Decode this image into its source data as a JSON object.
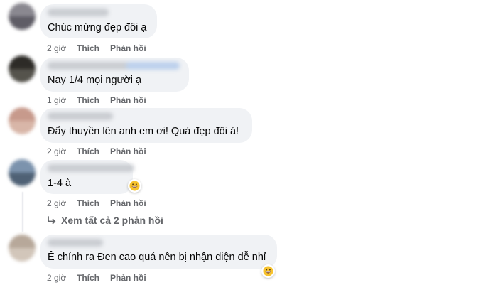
{
  "comments": [
    {
      "text": "Chúc mừng đẹp đôi ạ",
      "time": "2 giờ",
      "like": "Thích",
      "reply": "Phản hồi",
      "avatar_colors": [
        "#8a8890",
        "#5f5d66"
      ]
    },
    {
      "text": "Nay 1/4 mọi người ạ",
      "time": "1 giờ",
      "like": "Thích",
      "reply": "Phản hồi",
      "avatar_colors": [
        "#2d2b27",
        "#55534c"
      ]
    },
    {
      "text": "Đẩy thuyền lên anh em ơi! Quá đẹp đôi á!",
      "time": "2 giờ",
      "like": "Thích",
      "reply": "Phản hồi",
      "avatar_colors": [
        "#c79a8c",
        "#d8b6a8"
      ]
    },
    {
      "text": "1-4 à",
      "time": "2 giờ",
      "like": "Thích",
      "reply": "Phản hồi",
      "avatar_colors": [
        "#7c93ad",
        "#4f6175"
      ],
      "reaction": "grinning-emoji"
    },
    {
      "text": "Ê chính ra Đen cao quá nên bị nhận diện dễ nhỉ",
      "time": "2 giờ",
      "like": "Thích",
      "reply": "Phản hồi",
      "avatar_colors": [
        "#b7a89a",
        "#d2c6ba"
      ],
      "reaction": "grinning-emoji"
    }
  ],
  "view_replies": {
    "label": "Xem tất cả 2 phản hồi",
    "icon": "reply-arrow-icon"
  },
  "colors": {
    "bubble": "#f0f2f5",
    "text": "#050505",
    "meta": "#65676b"
  }
}
